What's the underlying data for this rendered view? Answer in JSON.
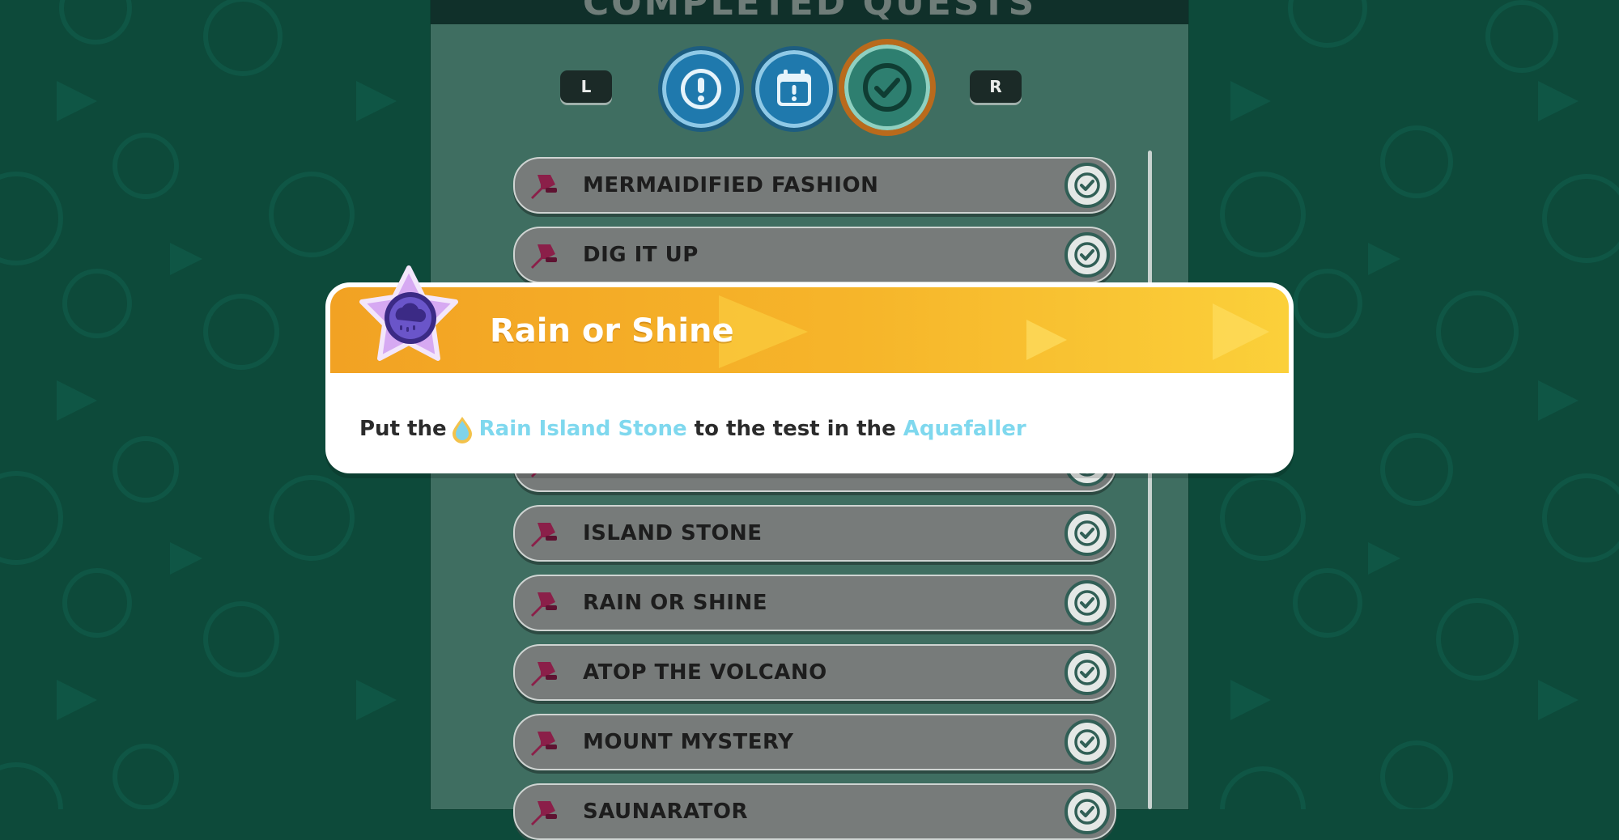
{
  "screen": {
    "title": "COMPLETED QUESTS",
    "left_shoulder": "L",
    "right_shoulder": "R",
    "tabs": [
      {
        "id": "quests",
        "icon": "exclamation-icon",
        "selected": false
      },
      {
        "id": "calendar",
        "icon": "calendar-exclamation-icon",
        "selected": false
      },
      {
        "id": "completed",
        "icon": "checkmark-icon",
        "selected": true
      }
    ]
  },
  "quests": [
    {
      "name": "MERMAIDIFIED FASHION",
      "completed": true
    },
    {
      "name": "DIG IT UP",
      "completed": true
    },
    {
      "name": "",
      "completed": true
    },
    {
      "name": "",
      "completed": true
    },
    {
      "name": "",
      "completed": true
    },
    {
      "name": "ISLAND STONE",
      "completed": true
    },
    {
      "name": "RAIN OR SHINE",
      "completed": true
    },
    {
      "name": "ATOP THE VOLCANO",
      "completed": true
    },
    {
      "name": "MOUNT MYSTERY",
      "completed": true
    },
    {
      "name": "SAUNARATOR",
      "completed": true
    }
  ],
  "popup": {
    "title": "Rain or Shine",
    "badge_icon": "rain-cloud-star-icon",
    "desc_prefix": "Put the",
    "desc_item": "Rain Island Stone",
    "desc_middle": "to the test in the",
    "desc_location": "Aquafaller",
    "colors": {
      "banner_start": "#f2a223",
      "banner_end": "#fbd03a",
      "link": "#7fd8ee"
    }
  },
  "colors": {
    "background": "#0d4a3a",
    "panel": "#3f6e61",
    "row": "#777b7a",
    "pin": "#8b1f49",
    "check_ring": "#315f56"
  }
}
